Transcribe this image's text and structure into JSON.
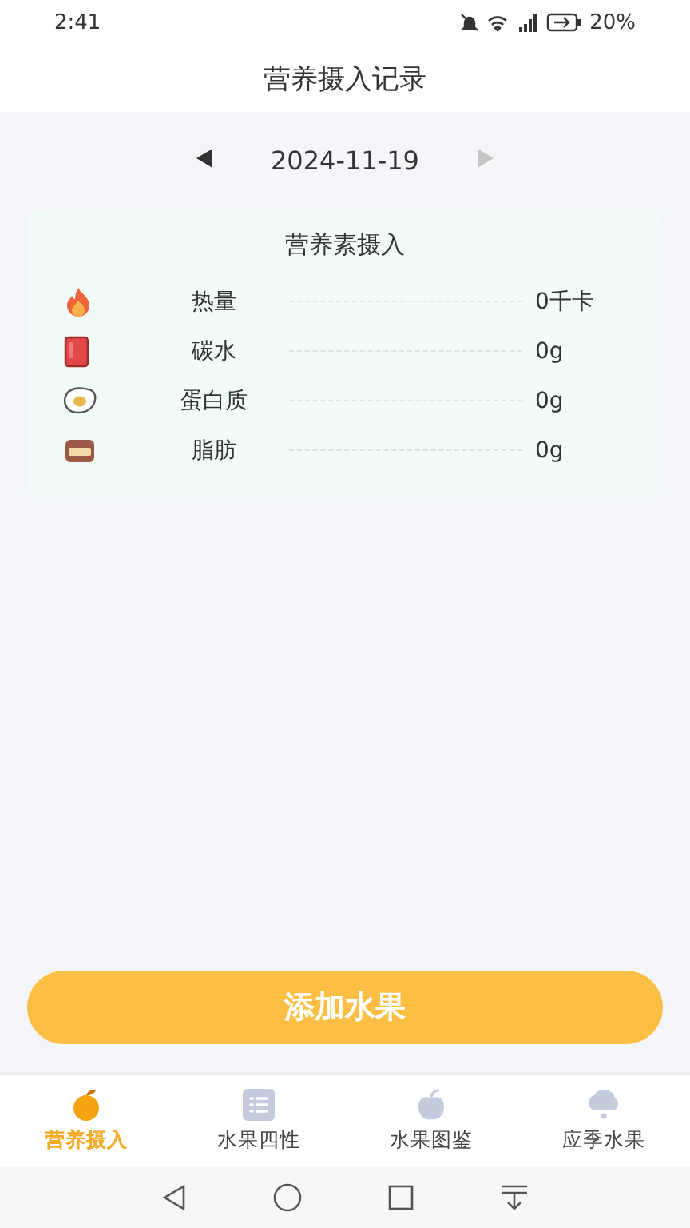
{
  "status_bar": {
    "time": "2:41",
    "battery": "20%"
  },
  "header": {
    "title": "营养摄入记录"
  },
  "date_nav": {
    "date": "2024-11-19",
    "prev_disabled": false,
    "next_disabled": true
  },
  "nutrition_card": {
    "title": "营养素摄入",
    "rows": [
      {
        "kind": "flame",
        "label": "热量",
        "value": "0千卡"
      },
      {
        "kind": "jar",
        "label": "碳水",
        "value": "0g"
      },
      {
        "kind": "egg",
        "label": "蛋白质",
        "value": "0g"
      },
      {
        "kind": "cake",
        "label": "脂肪",
        "value": "0g"
      }
    ]
  },
  "add_button": {
    "label": "添加水果"
  },
  "tabs": [
    {
      "kind": "orange",
      "label": "营养摄入",
      "selected": true
    },
    {
      "kind": "list",
      "label": "水果四性",
      "selected": false
    },
    {
      "kind": "apple",
      "label": "水果图鉴",
      "selected": false
    },
    {
      "kind": "cloud",
      "label": "应季水果",
      "selected": false
    }
  ]
}
